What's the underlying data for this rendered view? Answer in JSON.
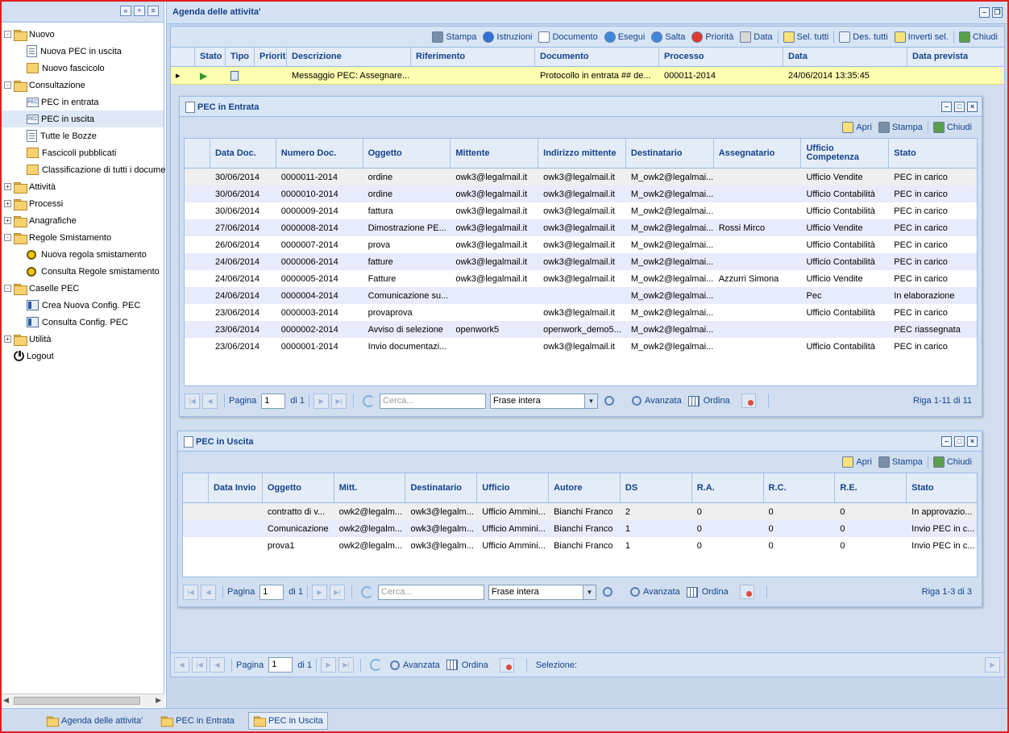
{
  "sidebar": {
    "tree": [
      {
        "label": "Nuovo",
        "type": "folder",
        "level": 0,
        "expander": "-"
      },
      {
        "label": "Nuova PEC in uscita",
        "type": "doc",
        "level": 1
      },
      {
        "label": "Nuovo fascicolo",
        "type": "fasc",
        "level": 1
      },
      {
        "label": "Consultazione",
        "type": "folder",
        "level": 0,
        "expander": "-"
      },
      {
        "label": "PEC in entrata",
        "type": "pec",
        "level": 1
      },
      {
        "label": "PEC in uscita",
        "type": "pec",
        "level": 1,
        "selected": true
      },
      {
        "label": "Tutte le Bozze",
        "type": "doc",
        "level": 1
      },
      {
        "label": "Fascicoli pubblicati",
        "type": "fasc",
        "level": 1
      },
      {
        "label": "Classificazione di tutti i documer",
        "type": "fasc",
        "level": 1
      },
      {
        "label": "Attività",
        "type": "folder",
        "level": 0,
        "expander": "+"
      },
      {
        "label": "Processi",
        "type": "folder",
        "level": 0,
        "expander": "+"
      },
      {
        "label": "Anagrafiche",
        "type": "folder",
        "level": 0,
        "expander": "+"
      },
      {
        "label": "Regole Smistamento",
        "type": "folder",
        "level": 0,
        "expander": "-"
      },
      {
        "label": "Nuova regola smistamento",
        "type": "gear",
        "level": 1
      },
      {
        "label": "Consulta Regole smistamento",
        "type": "gear",
        "level": 1
      },
      {
        "label": "Caselle PEC",
        "type": "folder",
        "level": 0,
        "expander": "-"
      },
      {
        "label": "Crea Nuova Config. PEC",
        "type": "config",
        "level": 1
      },
      {
        "label": "Consulta Config. PEC",
        "type": "config",
        "level": 1
      },
      {
        "label": "Utilità",
        "type": "folder",
        "level": 0,
        "expander": "+"
      },
      {
        "label": "Logout",
        "type": "power",
        "level": 0
      }
    ]
  },
  "main": {
    "title": "Agenda delle attivita'",
    "toolbar": [
      "Stampa",
      "Istruzioni",
      "Documento",
      "Esegui",
      "Salta",
      "Priorità",
      "Data",
      "Sel. tutti",
      "Des. tutti",
      "Inverti sel.",
      "Chiudi"
    ],
    "columns": [
      "Stato",
      "Tipo",
      "Priorit",
      "Descrizione",
      "Riferimento",
      "Documento",
      "Processo",
      "Data",
      "Data prevista"
    ],
    "row": {
      "descrizione": "Messaggio PEC: Assegnare...",
      "riferimento": "",
      "documento": "Protocollo in entrata ## de...",
      "processo": "000011-2014",
      "data": "24/06/2014 13:35:45",
      "data_prevista": ""
    },
    "pager": {
      "pagina": "Pagina",
      "page": "1",
      "di": "di 1",
      "avanzata": "Avanzata",
      "ordina": "Ordina",
      "selezione": "Selezione:"
    }
  },
  "pec_entrata": {
    "title": "PEC in Entrata",
    "toolbar": [
      "Apri",
      "Stampa",
      "Chiudi"
    ],
    "columns": [
      "Data Doc.",
      "Numero Doc.",
      "Oggetto",
      "Mittente",
      "Indirizzo mittente",
      "Destinatario",
      "Assegnatario",
      "Ufficio Competenza",
      "Stato"
    ],
    "rows": [
      [
        "30/06/2014",
        "0000011-2014",
        "ordine",
        "owk3@legalmail.it",
        "owk3@legalmail.it",
        "M_owk2@legalmai...",
        "",
        "Ufficio Vendite",
        "PEC in carico"
      ],
      [
        "30/06/2014",
        "0000010-2014",
        "ordine",
        "owk3@legalmail.it",
        "owk3@legalmail.it",
        "M_owk2@legalmai...",
        "",
        "Ufficio Contabilità",
        "PEC in carico"
      ],
      [
        "30/06/2014",
        "0000009-2014",
        "fattura",
        "owk3@legalmail.it",
        "owk3@legalmail.it",
        "M_owk2@legalmai...",
        "",
        "Ufficio Contabilità",
        "PEC in carico"
      ],
      [
        "27/06/2014",
        "0000008-2014",
        "Dimostrazione PE...",
        "owk3@legalmail.it",
        "owk3@legalmail.it",
        "M_owk2@legalmai...",
        "Rossi Mirco",
        "Ufficio Vendite",
        "PEC in carico"
      ],
      [
        "26/06/2014",
        "0000007-2014",
        "prova",
        "owk3@legalmail.it",
        "owk3@legalmail.it",
        "M_owk2@legalmai...",
        "",
        "Ufficio Contabilità",
        "PEC in carico"
      ],
      [
        "24/06/2014",
        "0000006-2014",
        "fatture",
        "owk3@legalmail.it",
        "owk3@legalmail.it",
        "M_owk2@legalmai...",
        "",
        "Ufficio Contabilità",
        "PEC in carico"
      ],
      [
        "24/06/2014",
        "0000005-2014",
        "Fatture",
        "owk3@legalmail.it",
        "owk3@legalmail.it",
        "M_owk2@legalmai...",
        "Azzurri Simona",
        "Ufficio Vendite",
        "PEC in carico"
      ],
      [
        "24/06/2014",
        "0000004-2014",
        "Comunicazione su...",
        "",
        "",
        "M_owk2@legalmai...",
        "",
        "Pec",
        "In elaborazione"
      ],
      [
        "23/06/2014",
        "0000003-2014",
        "provaprova",
        "",
        "owk3@legalmail.it",
        "M_owk2@legalmai...",
        "",
        "Ufficio Contabilità",
        "PEC in carico"
      ],
      [
        "23/06/2014",
        "0000002-2014",
        "Avviso di selezione",
        "openwork5",
        "openwork_demo5...",
        "M_owk2@legalmai...",
        "",
        "",
        "PEC riassegnata"
      ],
      [
        "23/06/2014",
        "0000001-2014",
        "Invio documentazi...",
        "",
        "owk3@legalmail.it",
        "M_owk2@legalmai...",
        "",
        "Ufficio Contabilità",
        "PEC in carico"
      ]
    ],
    "pager": {
      "pagina": "Pagina",
      "page": "1",
      "di": "di 1",
      "search_placeholder": "Cerca...",
      "mode": "Frase intera",
      "avanzata": "Avanzata",
      "ordina": "Ordina",
      "riga": "Riga 1-11 di 11"
    }
  },
  "pec_uscita": {
    "title": "PEC in Uscita",
    "toolbar": [
      "Apri",
      "Stampa",
      "Chiudi"
    ],
    "columns": [
      "Data Invio",
      "Oggetto",
      "Mitt.",
      "Destinatario",
      "Ufficio",
      "Autore",
      "DS",
      "R.A.",
      "R.C.",
      "R.E.",
      "Stato"
    ],
    "rows": [
      [
        "",
        "contratto di v...",
        "owk2@legalm...",
        "owk3@legalm...",
        "Ufficio Ammini...",
        "Bianchi Franco",
        "2",
        "0",
        "0",
        "0",
        "In approvazio..."
      ],
      [
        "",
        "Comunicazione",
        "owk2@legalm...",
        "owk3@legalm...",
        "Ufficio Ammini...",
        "Bianchi Franco",
        "1",
        "0",
        "0",
        "0",
        "Invio PEC in c..."
      ],
      [
        "",
        "prova1",
        "owk2@legalm...",
        "owk3@legalm...",
        "Ufficio Ammini...",
        "Bianchi Franco",
        "1",
        "0",
        "0",
        "0",
        "Invio PEC in c..."
      ]
    ],
    "pager": {
      "pagina": "Pagina",
      "page": "1",
      "di": "di 1",
      "search_placeholder": "Cerca...",
      "mode": "Frase intera",
      "avanzata": "Avanzata",
      "ordina": "Ordina",
      "riga": "Riga 1-3 di 3"
    }
  },
  "taskbar": [
    "Agenda delle attivita'",
    "PEC in Entrata",
    "PEC in Uscita"
  ],
  "colors": {
    "accent": "#15428b",
    "highlight_row": "#fefeb0",
    "frame": "#e0201e"
  }
}
